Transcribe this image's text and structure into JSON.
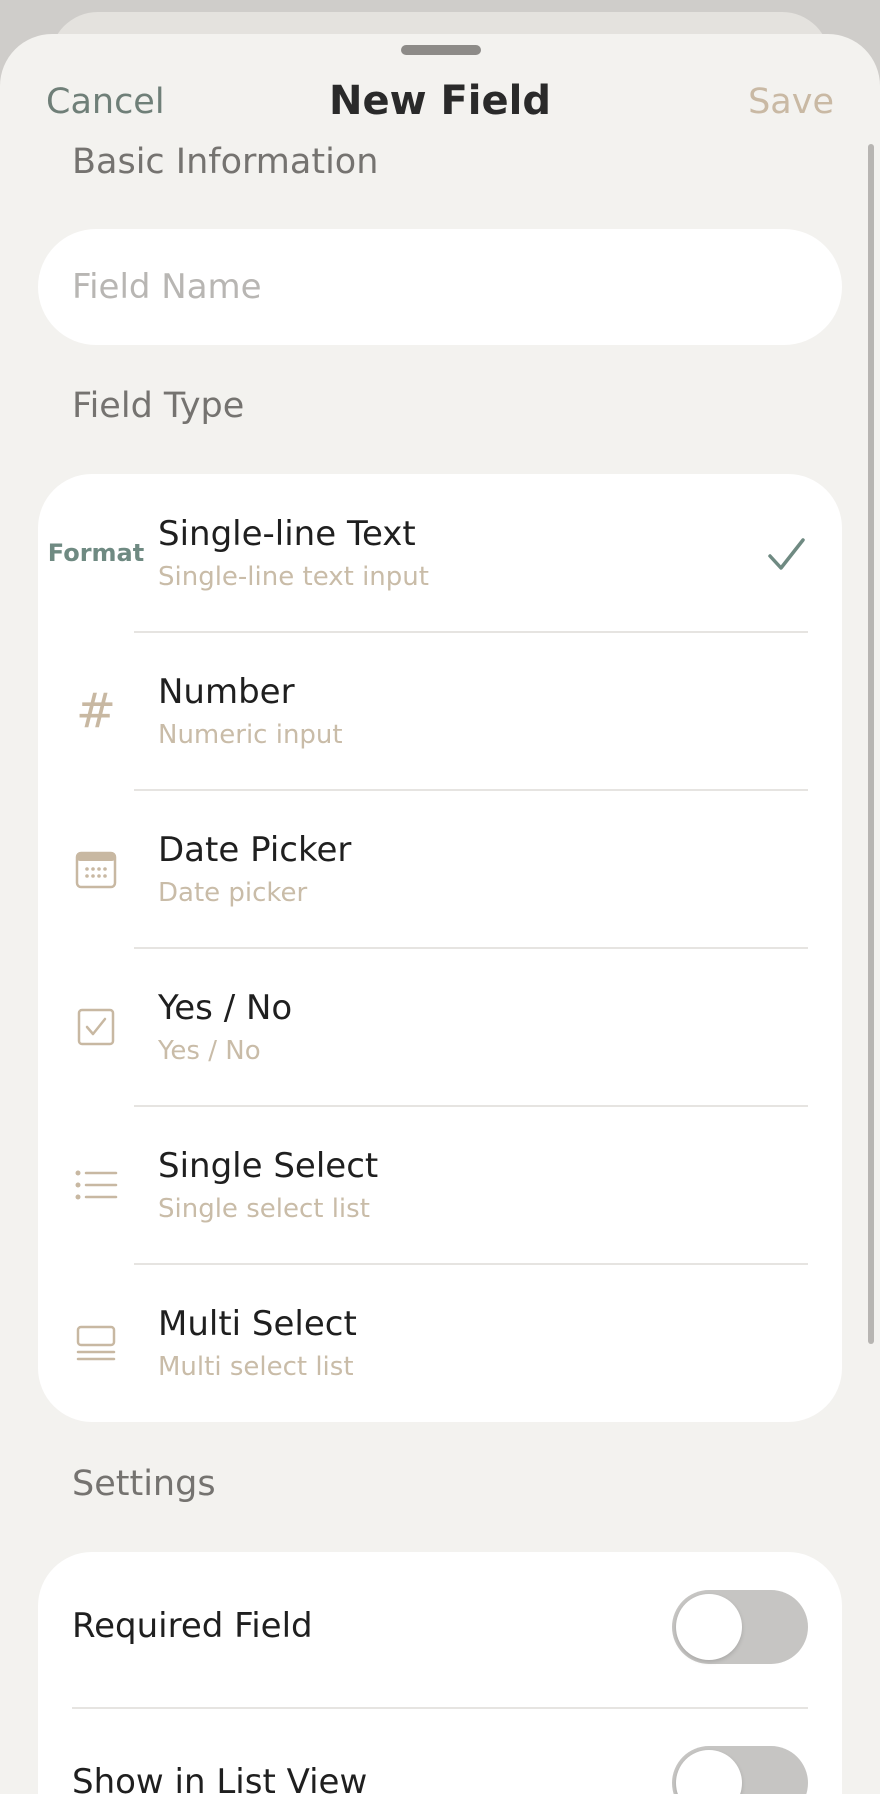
{
  "nav": {
    "cancel_label": "Cancel",
    "title": "New Field",
    "save_label": "Save"
  },
  "basic_info": {
    "section_label": "Basic Information",
    "field_name_placeholder": "Field Name",
    "field_name_value": ""
  },
  "field_type": {
    "section_label": "Field Type",
    "selected": "Single-line Text",
    "options": [
      {
        "icon": "format-text-icon",
        "icon_text": "Format",
        "title": "Single-line Text",
        "subtitle": "Single-line text input"
      },
      {
        "icon": "hash-icon",
        "icon_text": "#",
        "title": "Number",
        "subtitle": "Numeric input"
      },
      {
        "icon": "calendar-icon",
        "title": "Date Picker",
        "subtitle": "Date picker"
      },
      {
        "icon": "checkbox-icon",
        "title": "Yes / No",
        "subtitle": "Yes / No"
      },
      {
        "icon": "list-icon",
        "title": "Single Select",
        "subtitle": "Single select list"
      },
      {
        "icon": "multi-list-icon",
        "title": "Multi Select",
        "subtitle": "Multi select list"
      }
    ]
  },
  "settings": {
    "section_label": "Settings",
    "items": [
      {
        "label": "Required Field",
        "enabled": false
      },
      {
        "label": "Show in List View",
        "enabled": false
      }
    ]
  },
  "colors": {
    "accent": "#6f8a82",
    "icon_tint": "#c8b8a2",
    "save_disabled": "#c9b9a4",
    "background": "#f3f2ef"
  }
}
